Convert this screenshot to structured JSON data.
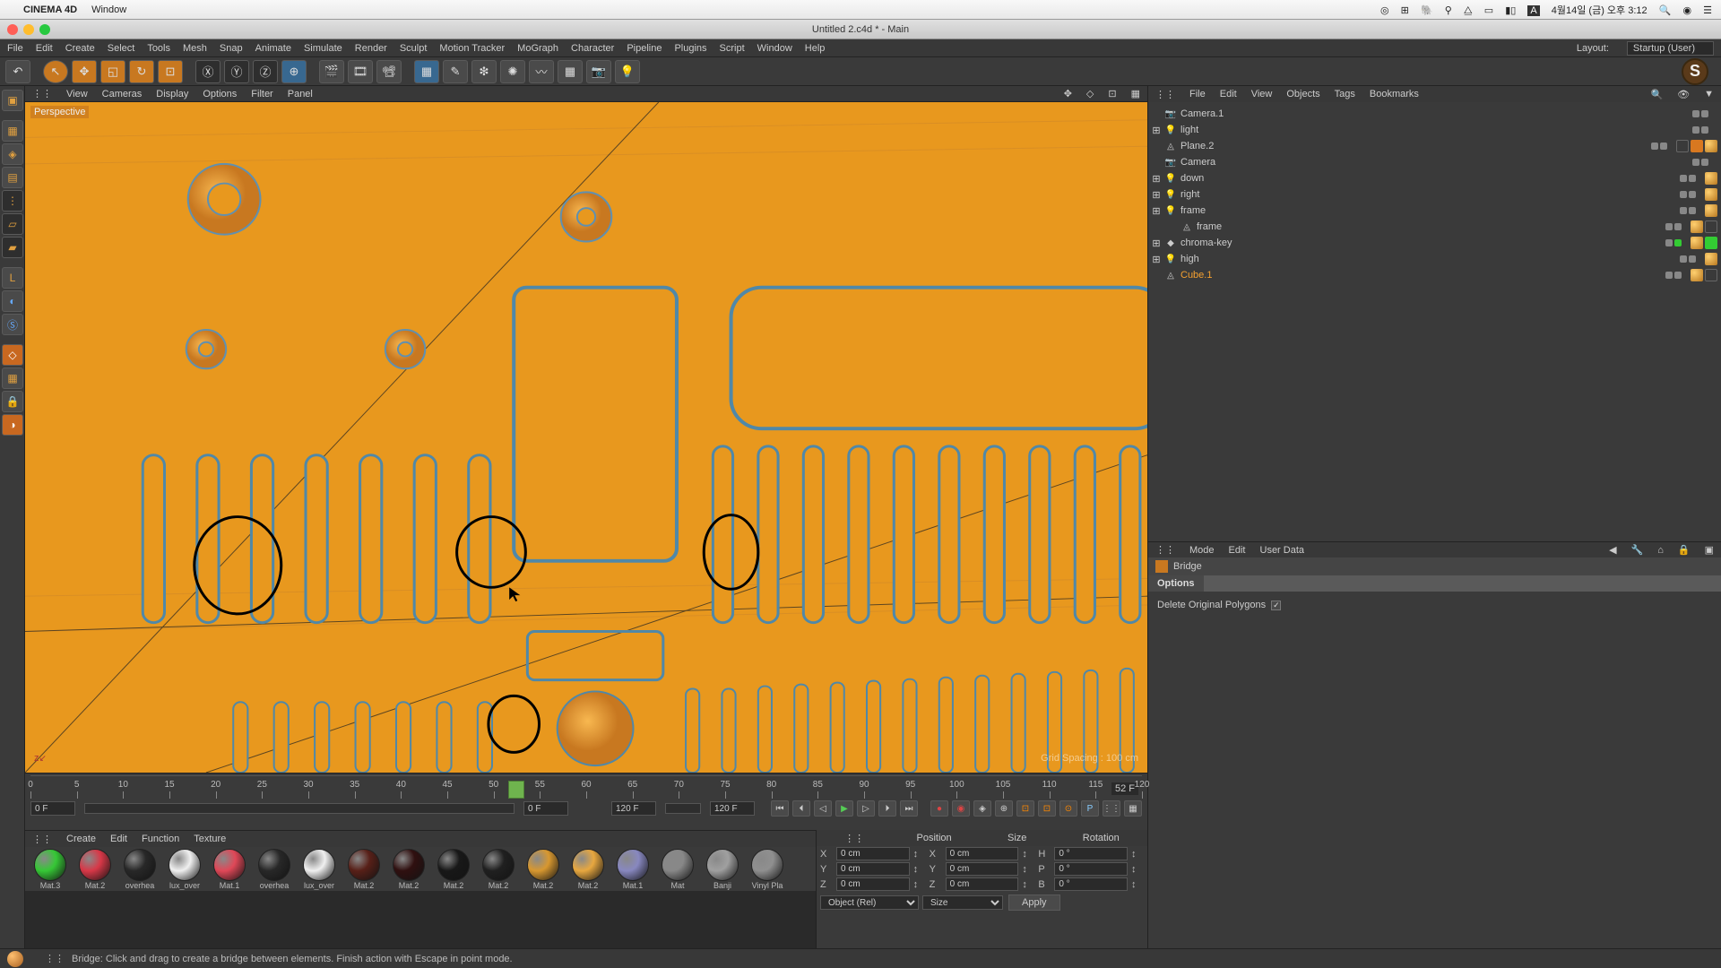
{
  "os_menu": {
    "app": "CINEMA 4D",
    "items": [
      "Window"
    ],
    "clock": "4월14일 (금) 오후 3:12"
  },
  "doc_title": "Untitled 2.c4d * - Main",
  "mainmenu": [
    "File",
    "Edit",
    "Create",
    "Select",
    "Tools",
    "Mesh",
    "Snap",
    "Animate",
    "Simulate",
    "Render",
    "Sculpt",
    "Motion Tracker",
    "MoGraph",
    "Character",
    "Pipeline",
    "Plugins",
    "Script",
    "Window",
    "Help"
  ],
  "layout": {
    "label": "Layout:",
    "value": "Startup (User)"
  },
  "view_menu": [
    "View",
    "Cameras",
    "Display",
    "Options",
    "Filter",
    "Panel"
  ],
  "viewport": {
    "persp": "Perspective",
    "grid": "Grid Spacing : 100 cm",
    "axes": "z"
  },
  "timeline": {
    "start": "0 F",
    "end": "120 F",
    "start2": "0 F",
    "end2": "120 F",
    "ticks": [
      0,
      5,
      10,
      15,
      20,
      25,
      30,
      35,
      40,
      45,
      50,
      55,
      60,
      65,
      70,
      75,
      80,
      85,
      90,
      95,
      100,
      105,
      110,
      115,
      120
    ],
    "current": "52 F",
    "playhead_labels": "5255"
  },
  "mat_menu": [
    "Create",
    "Edit",
    "Function",
    "Texture"
  ],
  "materials": [
    {
      "name": "Mat.3",
      "color": "#36c836"
    },
    {
      "name": "Mat.2",
      "color": "#d83848"
    },
    {
      "name": "overhea",
      "color": "#282828"
    },
    {
      "name": "lux_over",
      "color": "#f0f0f0"
    },
    {
      "name": "Mat.1",
      "color": "#e04858"
    },
    {
      "name": "overhea",
      "color": "#282828"
    },
    {
      "name": "lux_over",
      "color": "#f0f0f0"
    },
    {
      "name": "Mat.2",
      "color": "#582018"
    },
    {
      "name": "Mat.2",
      "color": "#301010"
    },
    {
      "name": "Mat.2",
      "color": "#181818"
    },
    {
      "name": "Mat.2",
      "color": "#202020"
    },
    {
      "name": "Mat.2",
      "color": "#d89830"
    },
    {
      "name": "Mat.2",
      "color": "#e8a840"
    },
    {
      "name": "Mat.1",
      "color": "#8888c0"
    },
    {
      "name": "Mat",
      "color": "#888888"
    },
    {
      "name": "Banji",
      "color": "#a0a0a0"
    },
    {
      "name": "Vinyl Pla",
      "color": "#909090"
    }
  ],
  "coord": {
    "headers": [
      "Position",
      "Size",
      "Rotation"
    ],
    "rows": [
      {
        "axis": "X",
        "p": "0 cm",
        "s": "0 cm",
        "rlab": "H",
        "r": "0 °"
      },
      {
        "axis": "Y",
        "p": "0 cm",
        "s": "0 cm",
        "rlab": "P",
        "r": "0 °"
      },
      {
        "axis": "Z",
        "p": "0 cm",
        "s": "0 cm",
        "rlab": "B",
        "r": "0 °"
      }
    ],
    "mode": "Object (Rel)",
    "size_mode": "Size",
    "apply": "Apply"
  },
  "obj_menu": [
    "File",
    "Edit",
    "View",
    "Objects",
    "Tags",
    "Bookmarks"
  ],
  "objects": [
    {
      "indent": 0,
      "exp": "",
      "icon": "📷",
      "name": "Camera.1",
      "tags": []
    },
    {
      "indent": 0,
      "exp": "⊞",
      "icon": "💡",
      "name": "light",
      "tags": []
    },
    {
      "indent": 0,
      "exp": "",
      "icon": "◬",
      "name": "Plane.2",
      "tags": [
        "check",
        "orange",
        "gold"
      ]
    },
    {
      "indent": 0,
      "exp": "",
      "icon": "📷",
      "name": "Camera",
      "tags": []
    },
    {
      "indent": 0,
      "exp": "⊞",
      "icon": "💡",
      "name": "down",
      "tags": [
        "gold"
      ]
    },
    {
      "indent": 0,
      "exp": "⊞",
      "icon": "💡",
      "name": "right",
      "tags": [
        "gold"
      ]
    },
    {
      "indent": 0,
      "exp": "⊞",
      "icon": "💡",
      "name": "frame",
      "tags": [
        "gold"
      ]
    },
    {
      "indent": 1,
      "exp": "",
      "icon": "◬",
      "name": "frame",
      "tags": [
        "gold",
        "check"
      ]
    },
    {
      "indent": 0,
      "exp": "⊞",
      "icon": "◆",
      "name": "chroma-key",
      "tags": [
        "gold",
        "green"
      ],
      "green": true
    },
    {
      "indent": 0,
      "exp": "⊞",
      "icon": "💡",
      "name": "high",
      "tags": [
        "gold"
      ]
    },
    {
      "indent": 0,
      "exp": "",
      "icon": "◬",
      "name": "Cube.1",
      "tags": [
        "gold",
        "check"
      ],
      "sel": true
    }
  ],
  "attr_menu": [
    "Mode",
    "Edit",
    "User Data"
  ],
  "attr": {
    "tool": "Bridge",
    "tab": "Options",
    "opt": "Delete Original Polygons"
  },
  "status": "Bridge: Click and drag to create a bridge between elements. Finish action with Escape in point mode."
}
